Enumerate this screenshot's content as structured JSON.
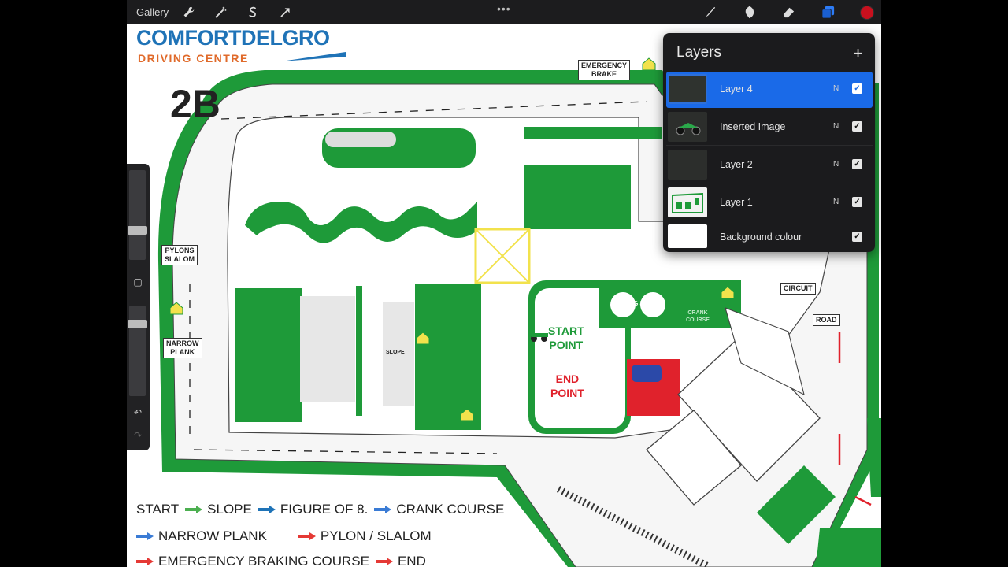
{
  "toolbar": {
    "gallery_label": "Gallery",
    "left_tools": [
      "wrench-icon",
      "magic-wand-icon",
      "selection-icon",
      "transform-arrow-icon"
    ],
    "more": "•••",
    "right_tools": [
      "brush-icon",
      "smudge-icon",
      "eraser-icon",
      "layers-icon"
    ],
    "active_color": "#c8101e"
  },
  "map": {
    "brand_top": "COMFORTDELGRO",
    "brand_bottom": "DRIVING CENTRE",
    "code": "2B",
    "signs": {
      "emergency_brake": "EMERGENCY\nBRAKE",
      "pylons_slalom": "PYLONS\nSLALOM",
      "narrow_plank": "NARROW\nPLANK",
      "circuit": "CIRCUIT",
      "road": "ROAD",
      "slope": "SLOPE",
      "fig8": "FIG 8",
      "crank": "CRANK\nCOURSE"
    },
    "start_point": "START\nPOINT",
    "end_point": "END\nPOINT",
    "legend": [
      [
        {
          "text": "START",
          "arrow_after": "#4caf50"
        },
        {
          "text": "SLOPE",
          "arrow_after": "#1f73b7"
        },
        {
          "text": "FIGURE OF 8.",
          "arrow_after": "#3a7bd5"
        },
        {
          "text": "CRANK COURSE",
          "arrow_after": ""
        }
      ],
      [
        {
          "text": "NARROW PLANK",
          "arrow_before": "#3a7bd5"
        },
        {
          "text": "PYLON / SLALOM",
          "arrow_before": "#e53935"
        }
      ],
      [
        {
          "text": "EMERGENCY BRAKING COURSE",
          "arrow_before": "#e53935"
        },
        {
          "text": "END",
          "arrow_before": "#e53935"
        }
      ]
    ]
  },
  "layers": {
    "title": "Layers",
    "add_label": "+",
    "items": [
      {
        "name": "Layer 4",
        "mode": "N",
        "visible": true,
        "active": true
      },
      {
        "name": "Inserted Image",
        "mode": "N",
        "visible": true,
        "active": false
      },
      {
        "name": "Layer 2",
        "mode": "N",
        "visible": true,
        "active": false
      },
      {
        "name": "Layer 1",
        "mode": "N",
        "visible": true,
        "active": false
      },
      {
        "name": "Background colour",
        "mode": "",
        "visible": true,
        "active": false
      }
    ]
  },
  "sidebar": {
    "tools": [
      "brush-size-slider",
      "modify-square-button",
      "opacity-slider",
      "undo-icon",
      "redo-icon"
    ]
  }
}
